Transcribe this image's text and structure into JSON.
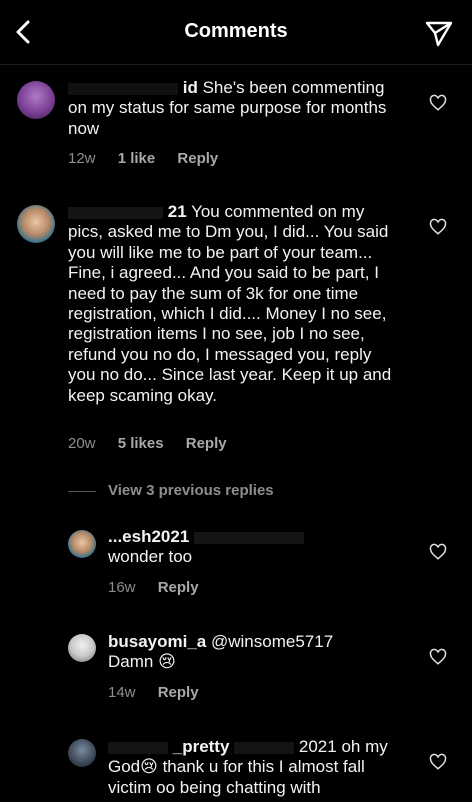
{
  "header": {
    "title": "Comments"
  },
  "comments": [
    {
      "username": "id",
      "text": "She's been commenting on my status for same purpose for months now",
      "time": "12w",
      "likes": "1 like",
      "reply": "Reply"
    },
    {
      "username": "21",
      "text": "You commented on my pics, asked me to Dm you, I did... You said you will like me to be part of your team... Fine, i agreed... And you said to be part, I need to pay the sum of 3k for one time registration, which I did.... Money I no see, registration items I no see, job I no see, refund you no do, I messaged you, reply you no do... Since last year. Keep it up and keep scaming okay.",
      "time": "20w",
      "likes": "5 likes",
      "reply": "Reply"
    }
  ],
  "view_more": "View 3 previous replies",
  "replies": [
    {
      "username": "...esh2021",
      "text": "wonder too",
      "time": "16w",
      "reply": "Reply"
    },
    {
      "username": "busayomi_a",
      "mention": "@winsome5717",
      "text": "Damn 😢",
      "time": "14w",
      "reply": "Reply"
    },
    {
      "username": "_pretty",
      "mention": "2021",
      "text": "oh my God😢 thank u for this I almost fall victim oo being chatting with"
    }
  ],
  "colors": {
    "background": "#000000",
    "text": "#f3f3f3",
    "meta": "#8e8e8e"
  }
}
